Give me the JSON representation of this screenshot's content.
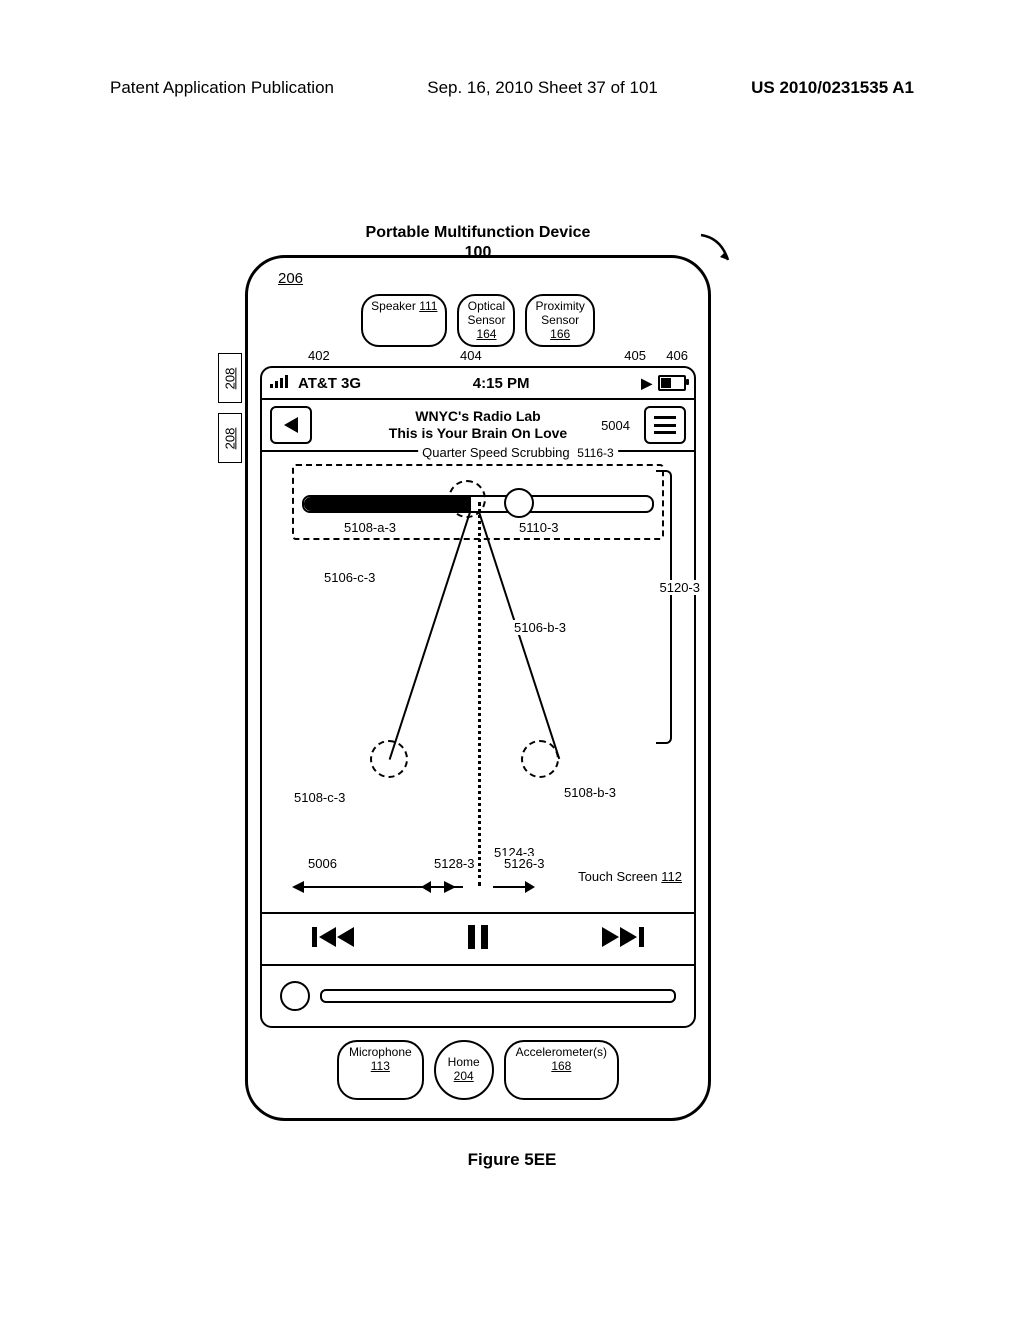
{
  "header": {
    "left": "Patent Application Publication",
    "center": "Sep. 16, 2010  Sheet 37 of 101",
    "right": "US 2010/0231535 A1"
  },
  "device": {
    "title": "Portable Multifunction Device",
    "ref_100": "100",
    "ref_206": "206",
    "ref_208": "208",
    "sensors": {
      "speaker": "Speaker",
      "speaker_num": "111",
      "optical": "Optical\nSensor",
      "optical_num": "164",
      "proximity": "Proximity\nSensor",
      "proximity_num": "166"
    },
    "hw": {
      "microphone": "Microphone",
      "microphone_num": "113",
      "home": "Home",
      "home_num": "204",
      "accel": "Accelerometer(s)",
      "accel_num": "168"
    }
  },
  "status": {
    "carrier": "AT&T 3G",
    "time": "4:15 PM"
  },
  "nav": {
    "title1": "WNYC's Radio Lab",
    "title2": "This is Your Brain On Love"
  },
  "scrub": {
    "label": "Quarter Speed Scrubbing"
  },
  "refs": {
    "r402": "402",
    "r404": "404",
    "r405": "405",
    "r406": "406",
    "r5004": "5004",
    "r5116_3": "5116-3",
    "r5108a3": "5108-a-3",
    "r5110_3": "5110-3",
    "r5106c3": "5106-c-3",
    "r5106b3": "5106-b-3",
    "r5120_3": "5120-3",
    "r5108c3": "5108-c-3",
    "r5108b3": "5108-b-3",
    "r5124_3": "5124-3",
    "r5006": "5006",
    "r5128_3": "5128-3",
    "r5126_3": "5126-3",
    "touchscreen": "Touch Screen",
    "touchscreen_num": "112"
  },
  "figure": "Figure 5EE"
}
